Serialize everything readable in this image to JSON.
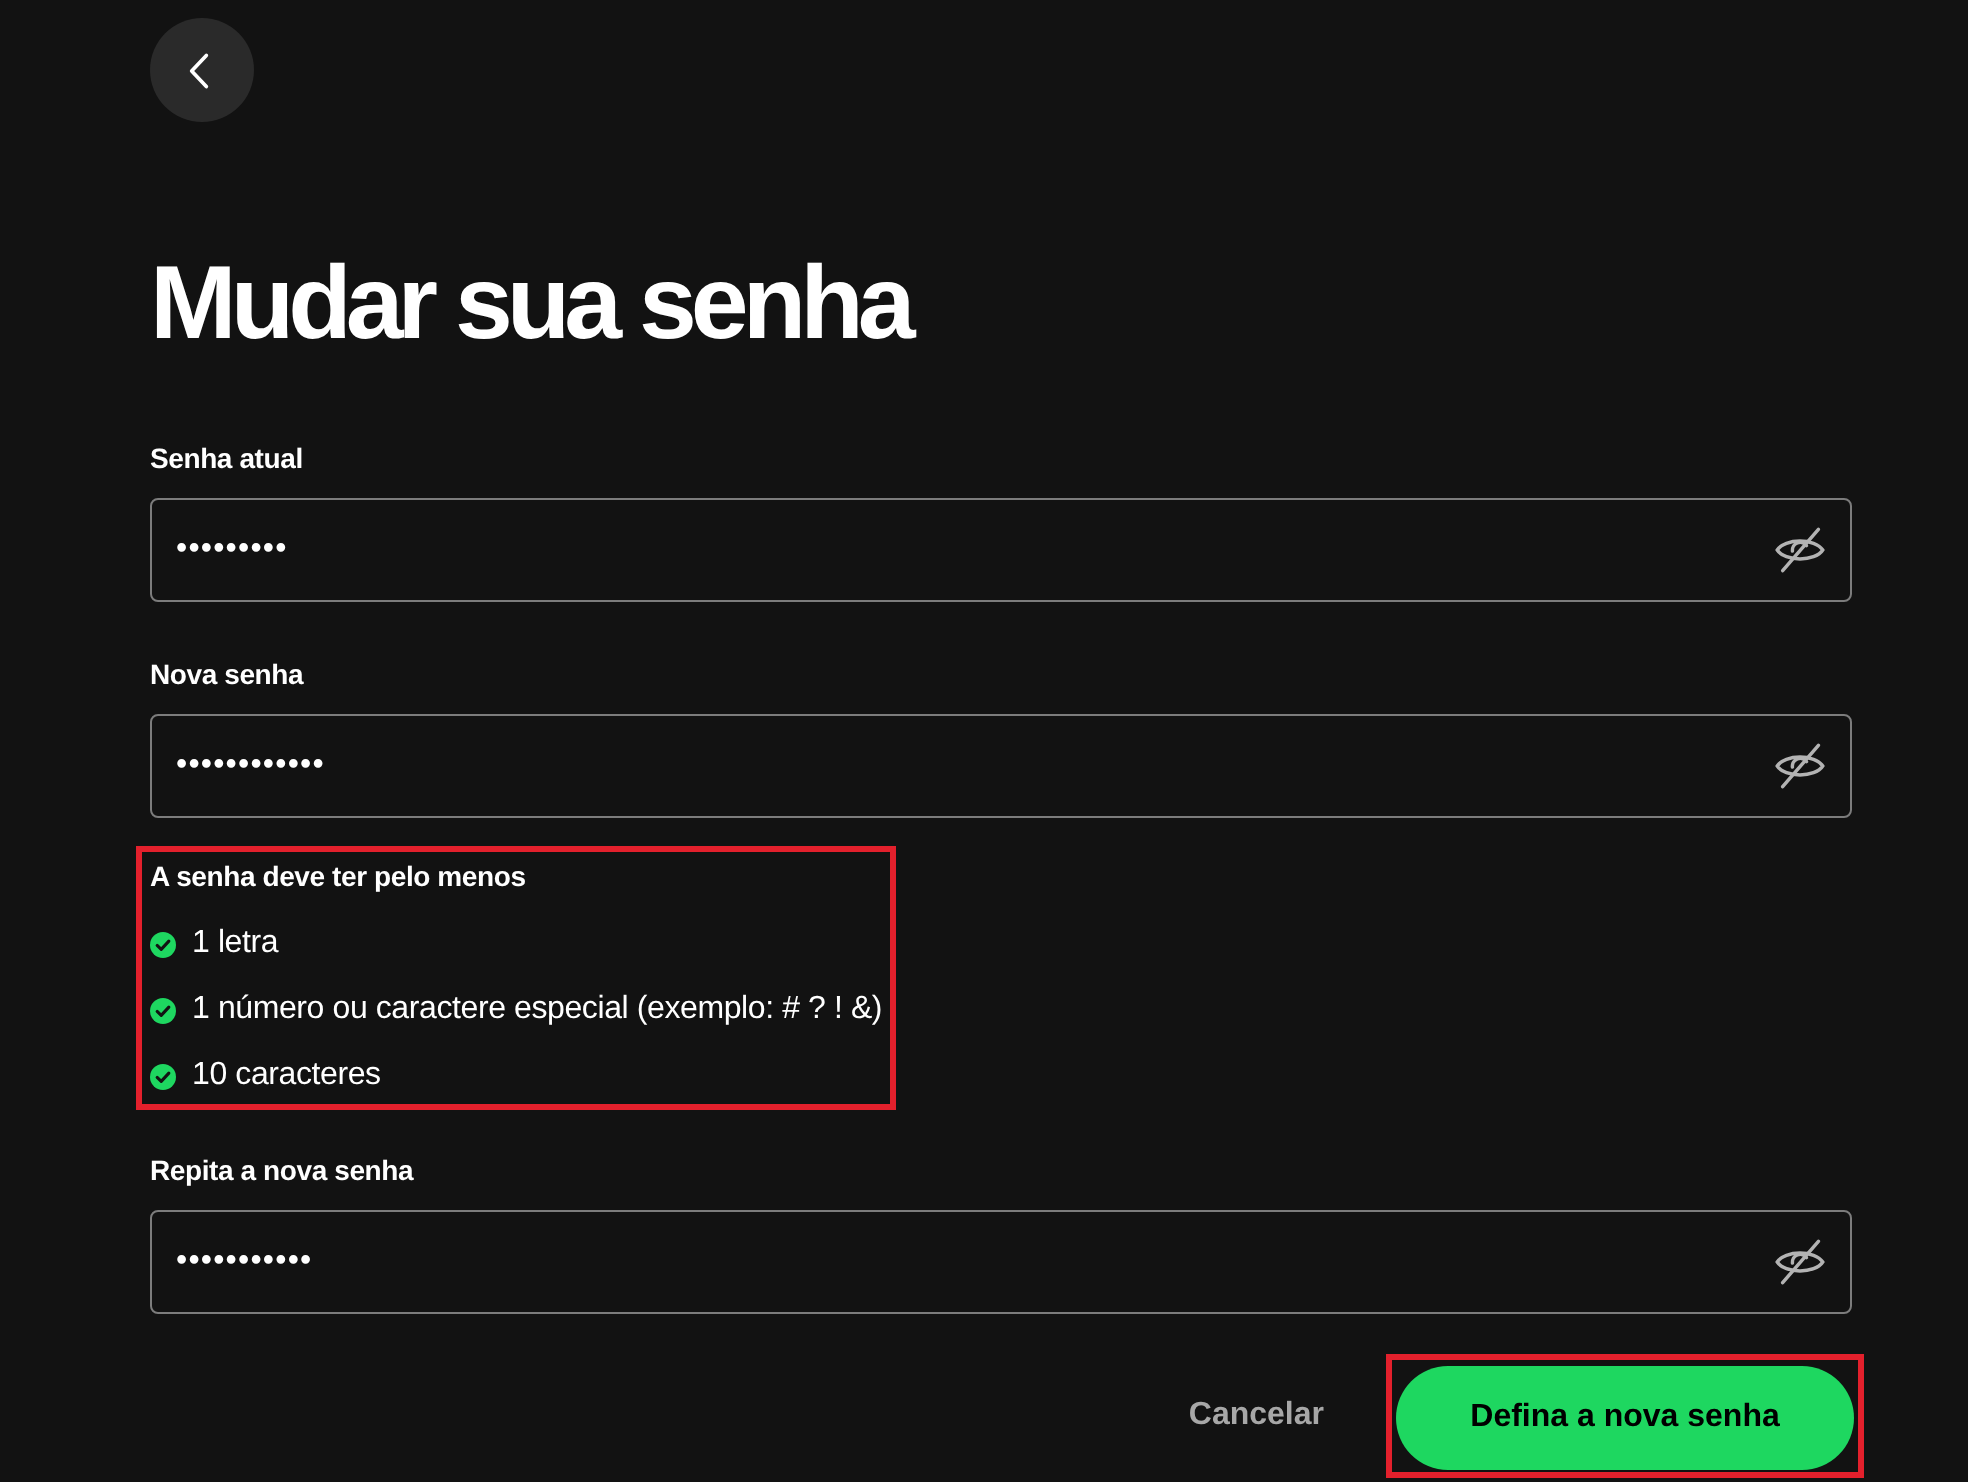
{
  "title": "Mudar sua senha",
  "current_password": {
    "label": "Senha atual",
    "value": "•••••••••"
  },
  "new_password": {
    "label": "Nova senha",
    "value": "••••••••••••"
  },
  "requirements": {
    "title": "A senha deve ter pelo menos",
    "highlighted": true,
    "items": [
      {
        "text": "1 letra",
        "met": true
      },
      {
        "text": "1 número ou caractere especial (exemplo: # ? ! &)",
        "met": true
      },
      {
        "text": "10 caracteres",
        "met": true
      }
    ]
  },
  "confirm_password": {
    "label": "Repita a nova senha",
    "value": "•••••••••••"
  },
  "buttons": [
    {
      "kind": "text",
      "label": "Cancelar",
      "highlighted": false
    },
    {
      "kind": "primary",
      "label": "Defina a nova senha",
      "highlighted": true
    }
  ]
}
